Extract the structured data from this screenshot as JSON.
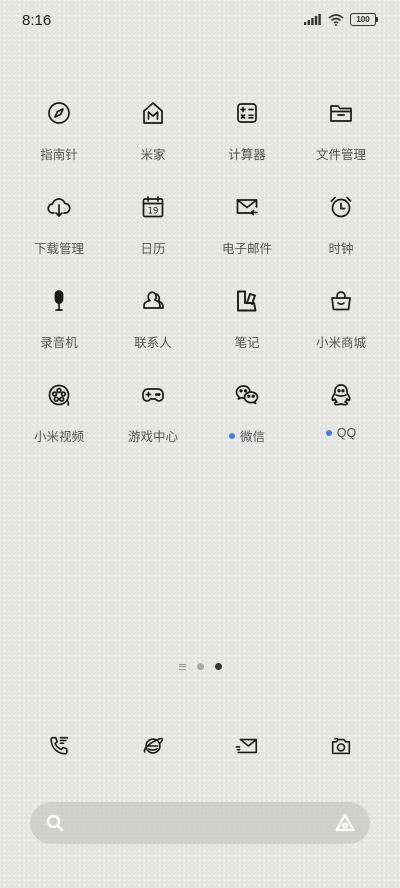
{
  "status_bar": {
    "time": "8:16",
    "battery": "100"
  },
  "apps": [
    {
      "label": "指南针",
      "icon": "compass-icon"
    },
    {
      "label": "米家",
      "icon": "mijia-icon"
    },
    {
      "label": "计算器",
      "icon": "calculator-icon"
    },
    {
      "label": "文件管理",
      "icon": "file-manager-icon"
    },
    {
      "label": "下载管理",
      "icon": "download-icon"
    },
    {
      "label": "日历",
      "icon": "calendar-icon"
    },
    {
      "label": "电子邮件",
      "icon": "email-icon"
    },
    {
      "label": "时钟",
      "icon": "alarm-clock-icon"
    },
    {
      "label": "录音机",
      "icon": "microphone-icon"
    },
    {
      "label": "联系人",
      "icon": "contacts-icon"
    },
    {
      "label": "笔记",
      "icon": "notes-icon"
    },
    {
      "label": "小米商城",
      "icon": "shopping-bag-icon"
    },
    {
      "label": "小米视频",
      "icon": "video-reel-icon"
    },
    {
      "label": "游戏中心",
      "icon": "gamepad-icon"
    },
    {
      "label": "微信",
      "icon": "wechat-icon"
    },
    {
      "label": "QQ",
      "icon": "qq-penguin-icon"
    }
  ],
  "calendar_day": "19",
  "page_indicator": {
    "pages": 2,
    "active": 2
  },
  "dock": [
    {
      "icon": "phone-icon"
    },
    {
      "icon": "browser-icon"
    },
    {
      "icon": "messages-icon"
    },
    {
      "icon": "camera-icon"
    }
  ],
  "search": {
    "placeholder": ""
  },
  "colors": {
    "accent": "#3d7ef0",
    "background": "#e6e6e4",
    "icon_stroke": "#1a1a1a"
  }
}
